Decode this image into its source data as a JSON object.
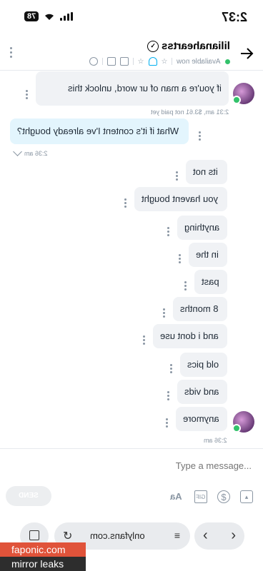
{
  "status": {
    "time": "2:37",
    "battery": "78"
  },
  "header": {
    "username": "lilianaheartss",
    "availability": "Available now"
  },
  "messages": [
    {
      "text": "if you're a man of ur word, unlock this",
      "meta": "2:31 am, $3.61 not paid yet"
    },
    {
      "text": "What if it's content I've already bought?",
      "meta": "2:36 am"
    },
    {
      "text": "its not"
    },
    {
      "text": "you havent bought"
    },
    {
      "text": "anything"
    },
    {
      "text": "in the"
    },
    {
      "text": "past"
    },
    {
      "text": "8 months"
    },
    {
      "text": "and i dont use"
    },
    {
      "text": "old pics"
    },
    {
      "text": "and vids"
    },
    {
      "text": "anymore",
      "meta": "2:36 am"
    }
  ],
  "composer": {
    "placeholder": "Type a message...",
    "send_label": "SEND",
    "text_format_label": "Aa",
    "gif_label": "GIF"
  },
  "browser": {
    "url": "onlyfans.com"
  },
  "watermark": {
    "line1": "faponic.com",
    "line2": "mirror leaks"
  },
  "colors": {
    "accent": "#00aff0",
    "online": "#33c26b",
    "incoming_bubble": "#f0f2f5",
    "outgoing_bubble": "#e3f5fd"
  },
  "icons": [
    "back-arrow-icon",
    "verified-icon",
    "star-icon",
    "bell-icon",
    "tag-icon",
    "image-icon",
    "search-icon",
    "kebab-icon",
    "dollar-icon",
    "reload-icon",
    "tabs-icon"
  ]
}
